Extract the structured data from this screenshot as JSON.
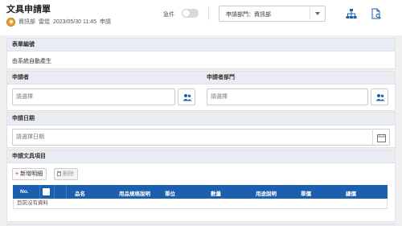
{
  "header": {
    "title": "文具申請單",
    "applicant_dept": "資訊部",
    "applicant_name": "雷焜",
    "datetime": "2023/05/30 11:45",
    "status": "申請",
    "toggle_label": "急件",
    "dept_select_value": "申請部門：資訊部",
    "icons": [
      "org-chart-icon",
      "document-search-icon"
    ]
  },
  "form": {
    "form_number": {
      "label": "表單編號",
      "value": "由系統自動產生"
    },
    "applicant": {
      "label": "申請者",
      "placeholder": "請選擇"
    },
    "applicant_department": {
      "label": "申請者部門",
      "placeholder": "請選擇"
    },
    "apply_date": {
      "label": "申請日期",
      "placeholder": "請選擇日期"
    },
    "items": {
      "label": "申請文具項目",
      "add_button": "新增明細",
      "delete_button": "刪除",
      "columns": [
        "No.",
        "",
        "品名",
        "用品規格說明",
        "單位",
        "數量",
        "用途說明",
        "單價",
        "總價"
      ],
      "empty_text": "目前沒有資料"
    }
  }
}
